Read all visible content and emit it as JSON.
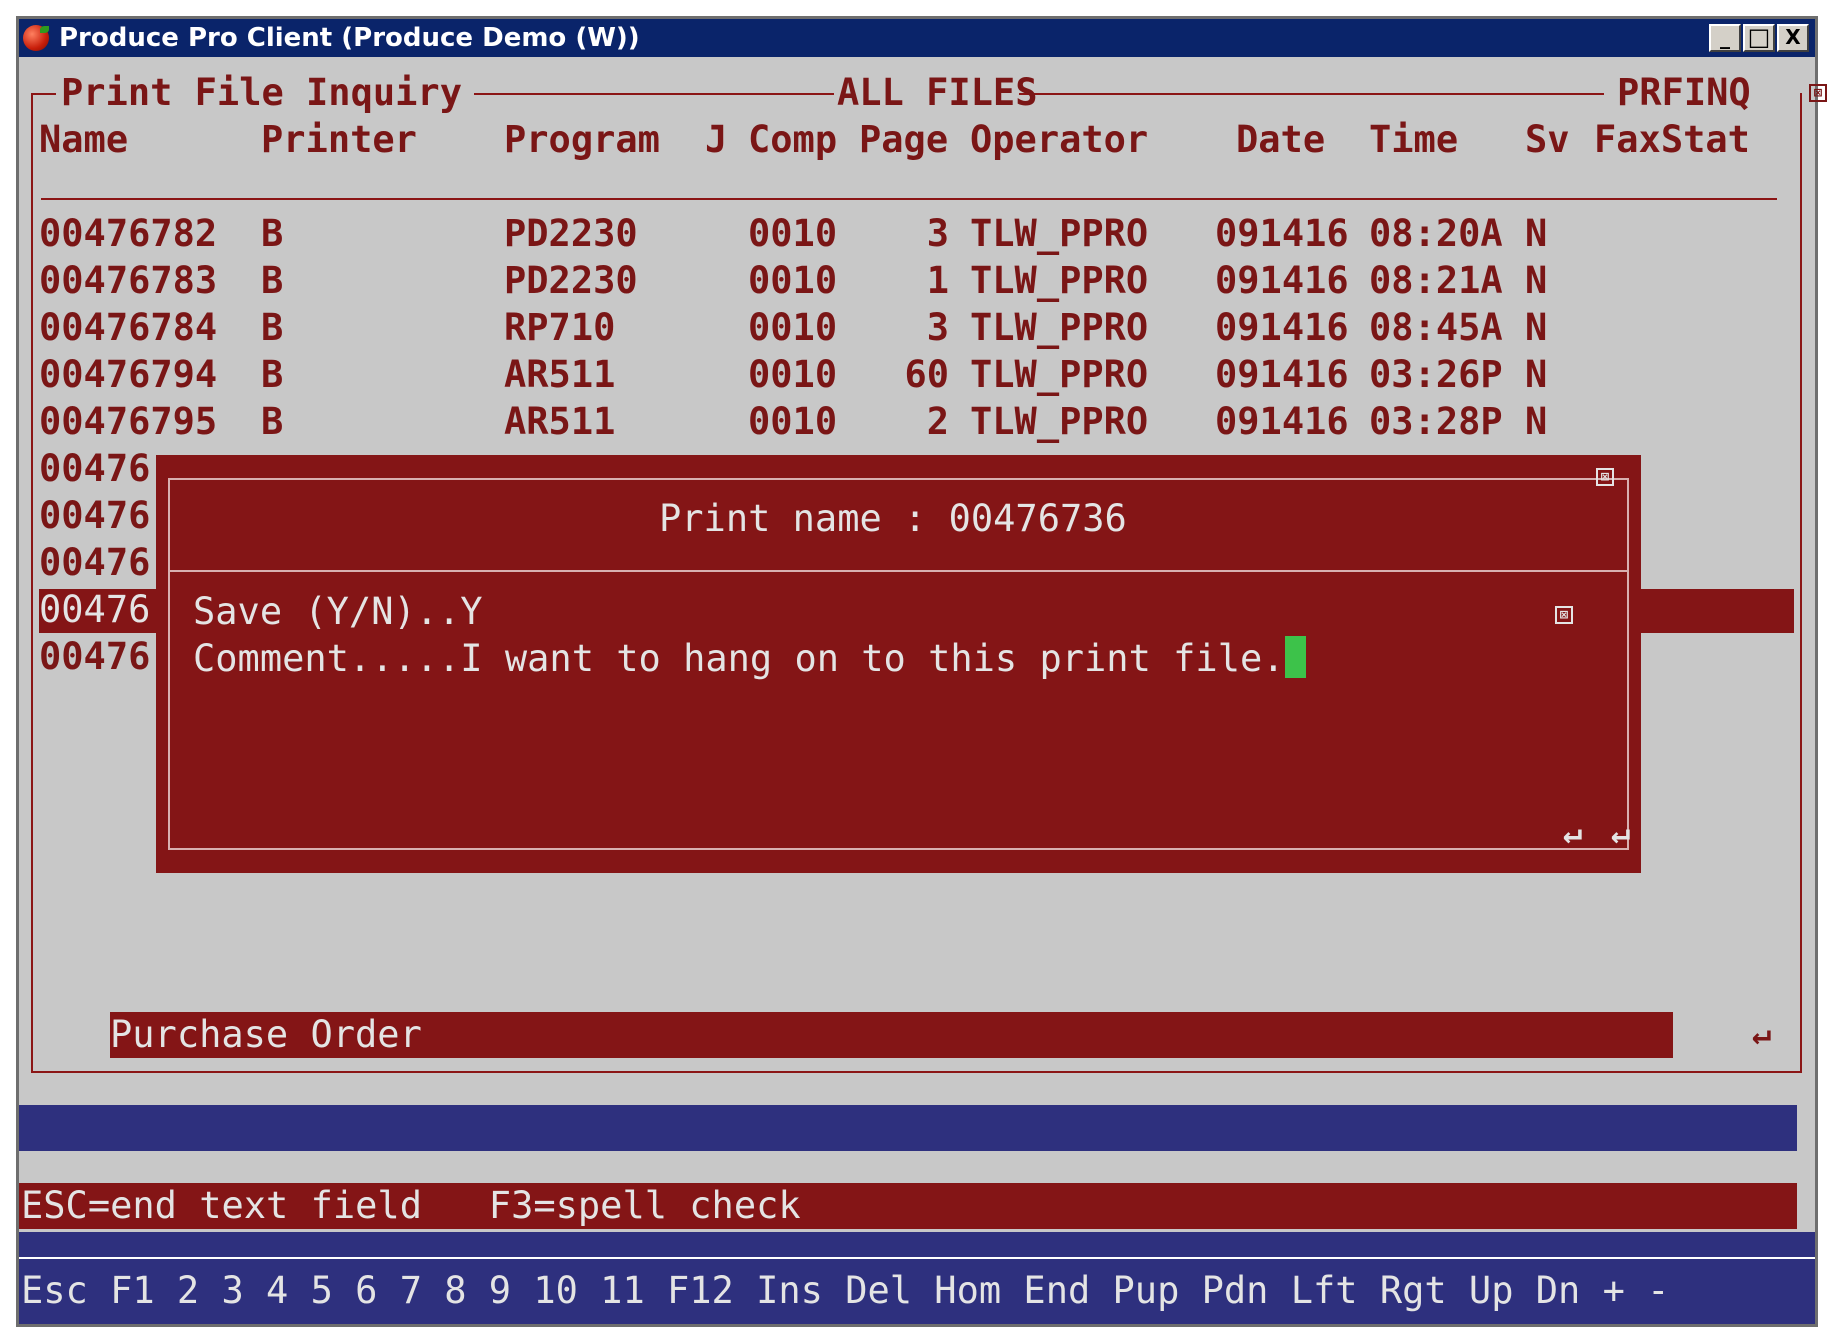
{
  "window": {
    "title": "Produce Pro Client (Produce Demo (W))",
    "minimize": "_",
    "maximize": "□",
    "close": "X"
  },
  "screen": {
    "heading": "Print File Inquiry",
    "filter": "ALL FILES",
    "program_code": "PRFINQ",
    "columns": [
      "Name",
      "Printer",
      "Program",
      "J",
      "Comp",
      "Page",
      "Operator",
      "Date",
      "Time",
      "Sv",
      "FaxStat"
    ],
    "rows": [
      {
        "name": "00476782",
        "printer": "B",
        "program": "PD2230",
        "comp": "0010",
        "page": "3",
        "operator": "TLW_PPRO",
        "date": "091416",
        "time": "08:20A",
        "sv": "N"
      },
      {
        "name": "00476783",
        "printer": "B",
        "program": "PD2230",
        "comp": "0010",
        "page": "1",
        "operator": "TLW_PPRO",
        "date": "091416",
        "time": "08:21A",
        "sv": "N"
      },
      {
        "name": "00476784",
        "printer": "B",
        "program": "RP710",
        "comp": "0010",
        "page": "3",
        "operator": "TLW_PPRO",
        "date": "091416",
        "time": "08:45A",
        "sv": "N"
      },
      {
        "name": "00476794",
        "printer": "B",
        "program": "AR511",
        "comp": "0010",
        "page": "60",
        "operator": "TLW_PPRO",
        "date": "091416",
        "time": "03:26P",
        "sv": "N"
      },
      {
        "name": "00476795",
        "printer": "B",
        "program": "AR511",
        "comp": "0010",
        "page": "2",
        "operator": "TLW_PPRO",
        "date": "091416",
        "time": "03:28P",
        "sv": "N"
      }
    ],
    "partial_rows": [
      "00476",
      "00476",
      "00476",
      "00476",
      "00476"
    ],
    "status_label": "Purchase Order"
  },
  "popup": {
    "print_name_label": "Print name : 00476736",
    "save_line": "Save (Y/N)..Y",
    "comment_line": "Comment.....I want to hang on to this print file."
  },
  "hints": "ESC=end text field   F3=spell check",
  "fkeys": "Esc F1 2 3 4 5 6 7 8 9 10 11 F12 Ins Del Hom End Pup Pdn Lft Rgt Up Dn + -",
  "enter_glyph": "↵",
  "close_glyph": "⊠",
  "colors": {
    "terminal_bg": "#c8c8c8",
    "accent_red": "#841516",
    "bar_blue": "#2e307e",
    "cursor_green": "#3dc24a"
  }
}
